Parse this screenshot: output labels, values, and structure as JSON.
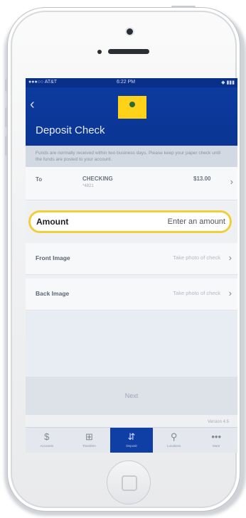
{
  "screen": {
    "title": "Deposit Check",
    "notice": "Funds are normally received within two business days. Please keep your paper check until the funds are posted to your account."
  },
  "status_bar": {
    "carrier": "●●●○○ AT&T",
    "time": "6:22 PM",
    "battery": "◆ ▮▮▮"
  },
  "to_row": {
    "label": "To",
    "account": "CHECKING",
    "account_sub": "*4821",
    "amount": "$13.00"
  },
  "amount_row": {
    "label": "Amount",
    "placeholder": "Enter an amount",
    "value": ""
  },
  "front_image": {
    "label": "Front Image",
    "hint": "Take photo of check"
  },
  "back_image": {
    "label": "Back Image",
    "hint": "Take photo of check"
  },
  "next_label": "Next",
  "version": "Version 4.5",
  "tabs": [
    {
      "label": "Accounts",
      "icon": "accounts-icon"
    },
    {
      "label": "Transfers",
      "icon": "transfers-icon"
    },
    {
      "label": "Deposit",
      "icon": "deposit-icon"
    },
    {
      "label": "Locations",
      "icon": "locations-icon"
    },
    {
      "label": "More",
      "icon": "more-icon"
    }
  ],
  "colors": {
    "header_blue": "#0c3a9e",
    "highlight_yellow": "#f2cf38",
    "logo_yellow": "#ffd21a"
  }
}
